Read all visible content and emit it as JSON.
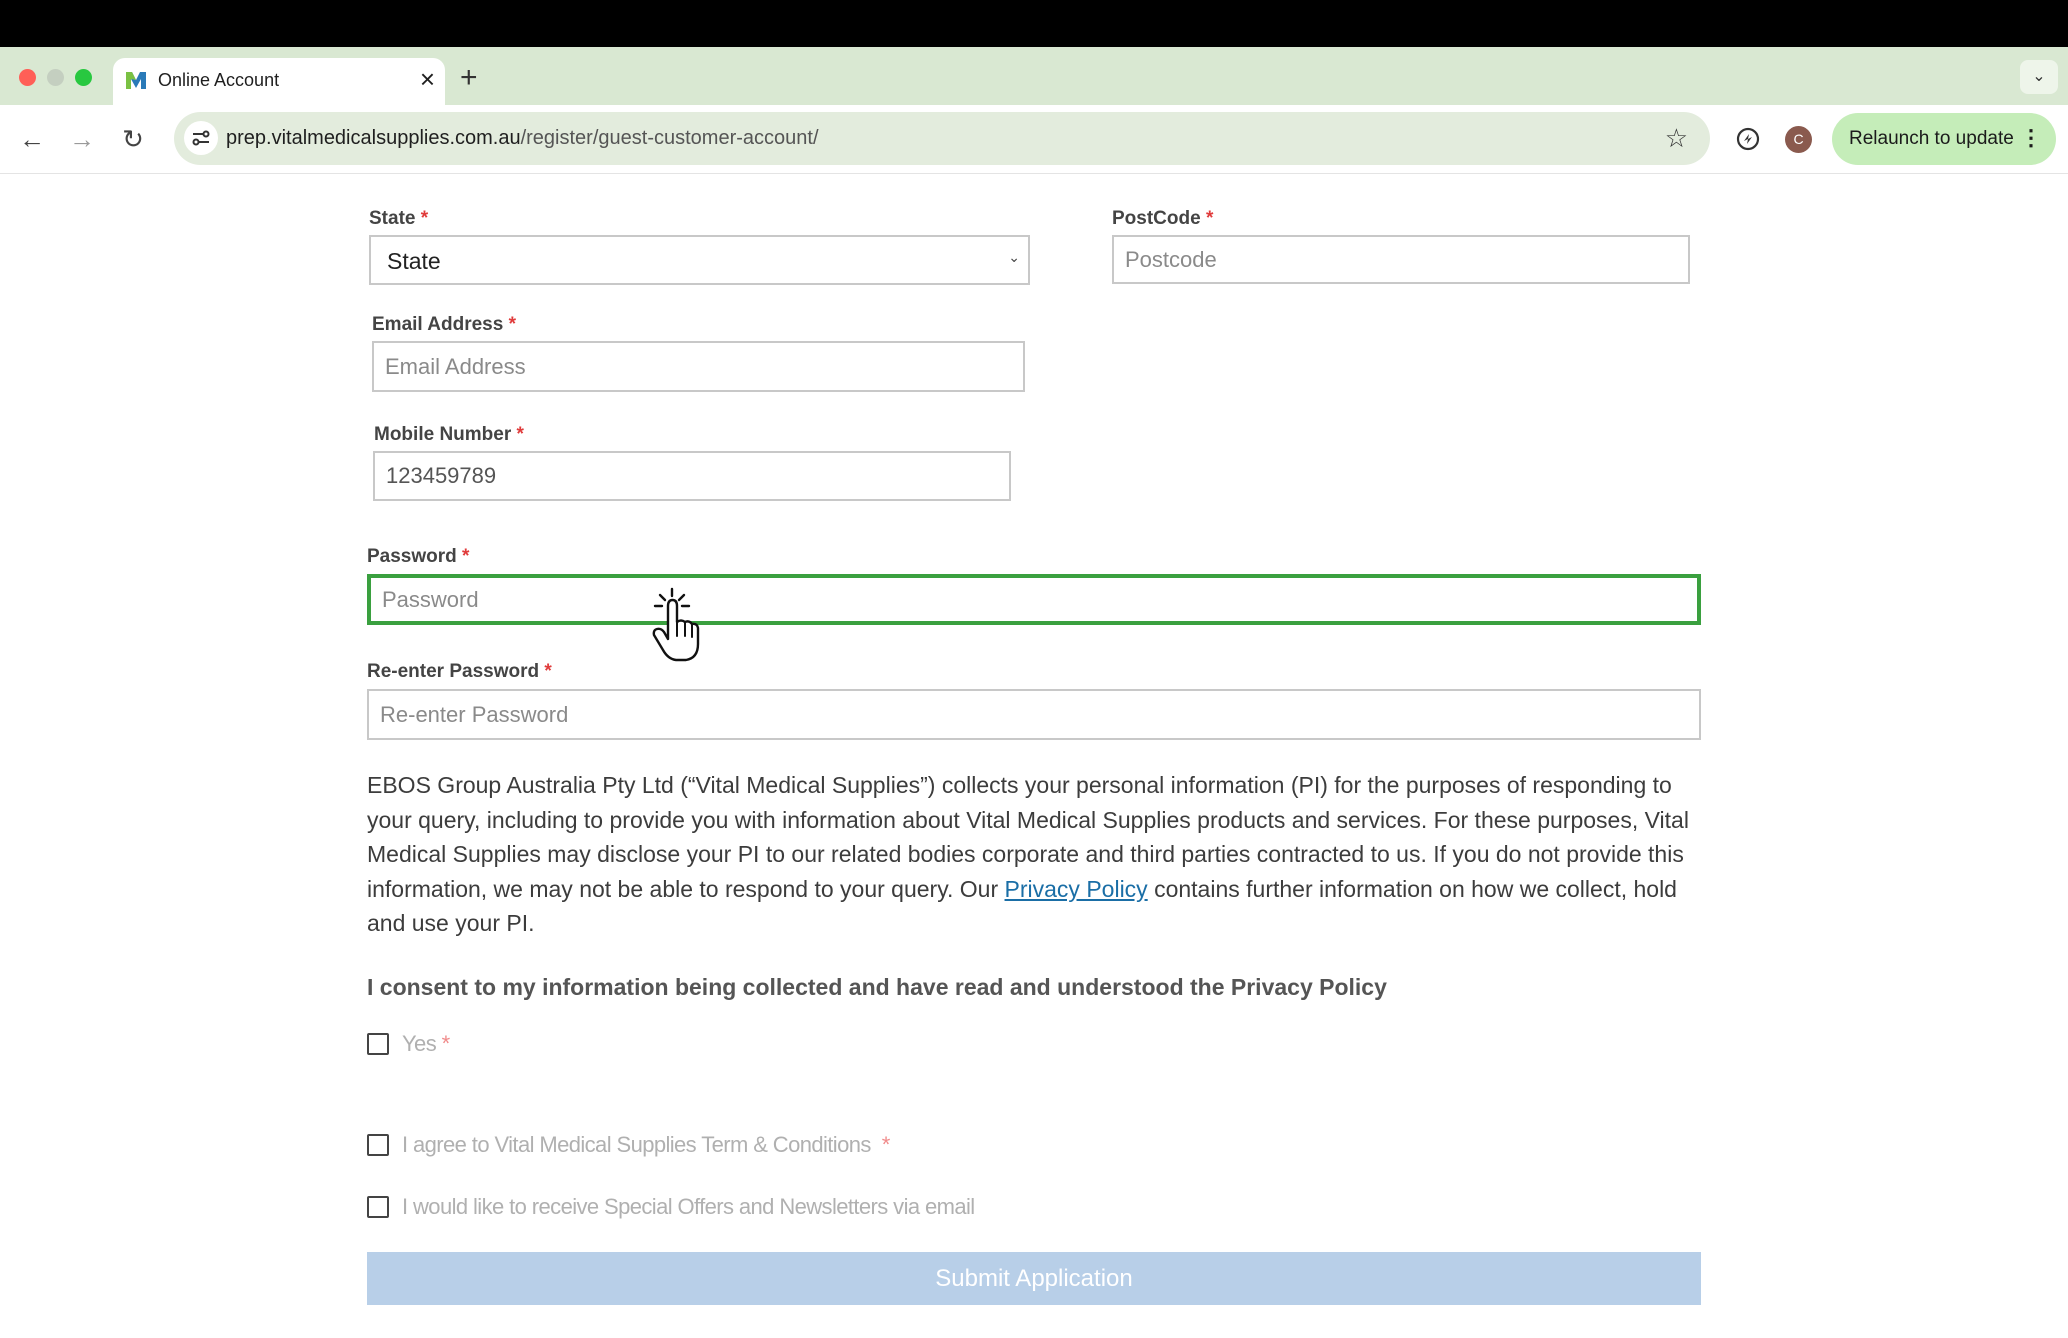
{
  "browser": {
    "tab_title": "Online Account",
    "new_tab_label": "+",
    "url_domain": "prep.vitalmedicalsupplies.com.au",
    "url_path": "/register/guest-customer-account/",
    "profile_initial": "C",
    "relaunch_label": "Relaunch to update",
    "icons": [
      "back-icon",
      "forward-icon",
      "reload-icon",
      "site-info-icon",
      "bookmark-star-icon",
      "extensions-icon",
      "more-menu-icon",
      "tab-search-icon"
    ]
  },
  "form": {
    "state": {
      "label": "State",
      "required": "*",
      "value": "State"
    },
    "postcode": {
      "label": "PostCode",
      "required": "*",
      "placeholder": "Postcode"
    },
    "email": {
      "label": "Email Address",
      "required": "*",
      "placeholder": "Email Address"
    },
    "mobile": {
      "label": "Mobile Number",
      "required": "*",
      "value": "123459789"
    },
    "password": {
      "label": "Password",
      "required": "*",
      "placeholder": "Password"
    },
    "reenter_password": {
      "label": "Re-enter Password",
      "required": "*",
      "placeholder": "Re-enter Password"
    },
    "privacy_notice": {
      "text_before": "EBOS Group Australia Pty Ltd (“Vital Medical Supplies”) collects your personal information (PI) for the purposes of responding to your query, including to provide you with information about Vital Medical Supplies products and services.  For these purposes, Vital Medical Supplies may disclose your PI to our related bodies corporate and third parties contracted to us. If you do not provide this information, we may not be able to respond to your query. Our ",
      "link_text": "Privacy Policy",
      "text_after": " contains further information on how we collect, hold and use your PI."
    },
    "consent_title": "I consent to my information being collected and have read and understood the Privacy Policy",
    "consent_yes": {
      "label": "Yes",
      "required": "*"
    },
    "terms": {
      "label": "I agree to Vital Medical Supplies Term & Conditions",
      "required": "*"
    },
    "newsletter": {
      "label": "I would like to receive Special Offers and Newsletters via email"
    },
    "submit_label": "Submit Application"
  },
  "colors": {
    "focus_border": "#3aa03f",
    "submit_bg": "#b8cfe8",
    "link": "#1a6ea6",
    "required": "#e03b3b",
    "tabstrip_bg": "#d9e8d2",
    "relaunch_bg": "#c5edb9"
  }
}
